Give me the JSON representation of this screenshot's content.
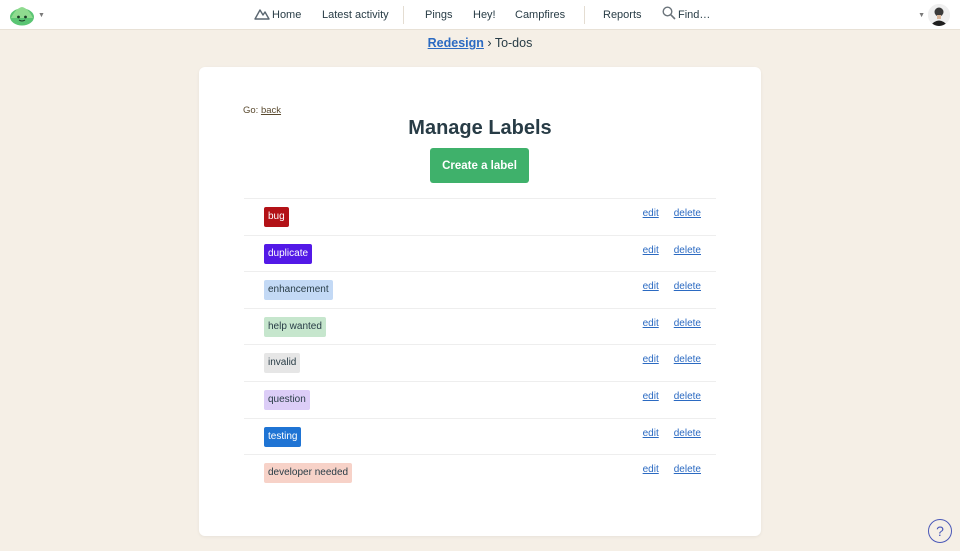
{
  "nav": {
    "home": "Home",
    "latest_activity": "Latest activity",
    "pings": "Pings",
    "hey": "Hey!",
    "campfires": "Campfires",
    "reports": "Reports",
    "find": "Find…",
    "icons": {
      "logo": "basecamp-logo-icon",
      "home": "mountain-home-icon",
      "find": "search-icon",
      "caret": "caret-down-icon"
    }
  },
  "breadcrumb": {
    "project": "Redesign",
    "separator": " › ",
    "current": "To-dos"
  },
  "page": {
    "go_label": "Go:",
    "back_link": "back",
    "title": "Manage Labels",
    "create_button": "Create a label"
  },
  "labels": [
    {
      "name": "bug",
      "bg": "#b31217",
      "fg": "#ffffff",
      "edit": "edit",
      "delete": "delete"
    },
    {
      "name": "duplicate",
      "bg": "#5319e7",
      "fg": "#ffffff",
      "edit": "edit",
      "delete": "delete"
    },
    {
      "name": "enhancement",
      "bg": "#c3d9f5",
      "fg": "#283c46",
      "edit": "edit",
      "delete": "delete"
    },
    {
      "name": "help wanted",
      "bg": "#c6e6cd",
      "fg": "#283c46",
      "edit": "edit",
      "delete": "delete"
    },
    {
      "name": "invalid",
      "bg": "#e6e6e6",
      "fg": "#283c46",
      "edit": "edit",
      "delete": "delete"
    },
    {
      "name": "question",
      "bg": "#dccdf7",
      "fg": "#283c46",
      "edit": "edit",
      "delete": "delete"
    },
    {
      "name": "testing",
      "bg": "#1f74d4",
      "fg": "#ffffff",
      "edit": "edit",
      "delete": "delete"
    },
    {
      "name": "developer needed",
      "bg": "#f7d2c8",
      "fg": "#283c46",
      "edit": "edit",
      "delete": "delete"
    }
  ],
  "help": {
    "glyph": "?",
    "icon": "help-question-icon"
  },
  "colors": {
    "background": "#f5efe6",
    "primary_button": "#3fb16b",
    "link": "#2b6ac2",
    "text": "#283c46"
  }
}
